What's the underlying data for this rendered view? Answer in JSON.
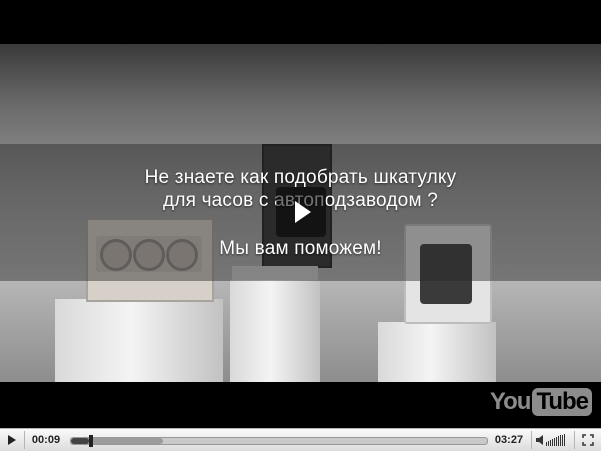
{
  "video": {
    "overlay_text": {
      "line1": "Не знаете как подобрать шкатулку",
      "line2": "для часов с автоподзаводом ?",
      "line3": "Мы вам поможем!"
    }
  },
  "logo": {
    "part1": "You",
    "part2": "Tube"
  },
  "controls": {
    "current_time": "00:09",
    "duration": "03:27",
    "played_fraction": 0.043,
    "buffered_fraction": 0.22
  },
  "icons": [
    "play-icon",
    "volume-icon",
    "fullscreen-icon"
  ]
}
